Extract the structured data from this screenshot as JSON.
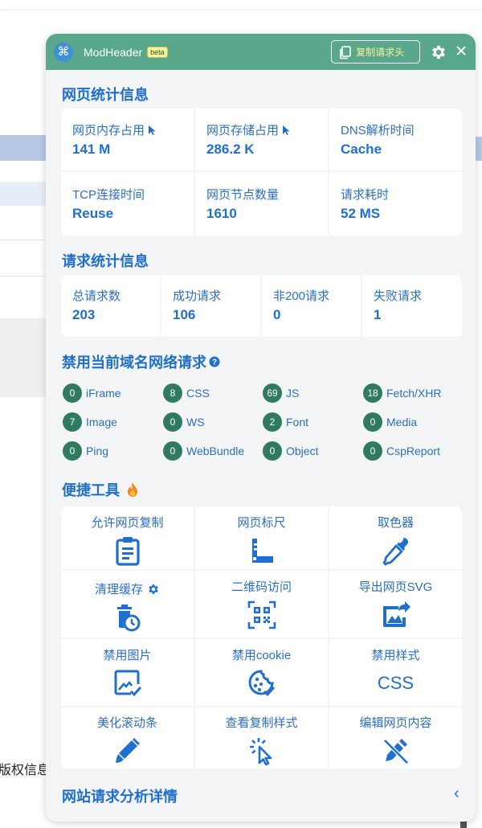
{
  "background": {
    "text": "版权信息"
  },
  "header": {
    "app_name": "ModHeader",
    "beta": "beta",
    "copy_label": "复制请求头",
    "close": "✕"
  },
  "page_stats": {
    "title": "网页统计信息",
    "cells": [
      {
        "label": "网页内存占用",
        "value": "141 M"
      },
      {
        "label": "网页存储占用",
        "value": "286.2 K"
      },
      {
        "label": "DNS解析时间",
        "value": "Cache"
      },
      {
        "label": "TCP连接时间",
        "value": "Reuse"
      },
      {
        "label": "网页节点数量",
        "value": "1610"
      },
      {
        "label": "请求耗时",
        "value": "52 MS"
      }
    ]
  },
  "request_stats": {
    "title": "请求统计信息",
    "cells": [
      {
        "label": "总请求数",
        "value": "203"
      },
      {
        "label": "成功请求",
        "value": "106"
      },
      {
        "label": "非200请求",
        "value": "0"
      },
      {
        "label": "失败请求",
        "value": "1"
      }
    ]
  },
  "block_network": {
    "title": "禁用当前域名网络请求",
    "items": [
      {
        "count": "0",
        "label": "iFrame"
      },
      {
        "count": "8",
        "label": "CSS"
      },
      {
        "count": "69",
        "label": "JS"
      },
      {
        "count": "18",
        "label": "Fetch/XHR"
      },
      {
        "count": "7",
        "label": "Image"
      },
      {
        "count": "0",
        "label": "WS"
      },
      {
        "count": "2",
        "label": "Font"
      },
      {
        "count": "0",
        "label": "Media"
      },
      {
        "count": "0",
        "label": "Ping"
      },
      {
        "count": "0",
        "label": "WebBundle"
      },
      {
        "count": "0",
        "label": "Object"
      },
      {
        "count": "0",
        "label": "CspReport"
      }
    ]
  },
  "tools": {
    "title": "便捷工具",
    "items": [
      {
        "label": "允许网页复制",
        "icon": "clipboard-icon"
      },
      {
        "label": "网页标尺",
        "icon": "ruler-icon"
      },
      {
        "label": "取色器",
        "icon": "eyedropper-icon"
      },
      {
        "label": "清理缓存",
        "icon": "trash-clock-icon"
      },
      {
        "label": "二维码访问",
        "icon": "qrcode-icon"
      },
      {
        "label": "导出网页SVG",
        "icon": "image-export-icon"
      },
      {
        "label": "禁用图片",
        "icon": "image-check-icon"
      },
      {
        "label": "禁用cookie",
        "icon": "cookie-icon"
      },
      {
        "label": "禁用样式",
        "icon": "css-text",
        "text": "CSS"
      },
      {
        "label": "美化滚动条",
        "icon": "marker-icon"
      },
      {
        "label": "查看复制样式",
        "icon": "cursor-click-icon"
      },
      {
        "label": "编辑网页内容",
        "icon": "pen-off-icon"
      }
    ]
  },
  "footer": {
    "title": "网站请求分析详情",
    "chevron": "‹"
  },
  "colors": {
    "header": "#5aa88c",
    "accent": "#1f6fd0",
    "badge": "#2f7a60",
    "panel": "#f4f5f7"
  }
}
